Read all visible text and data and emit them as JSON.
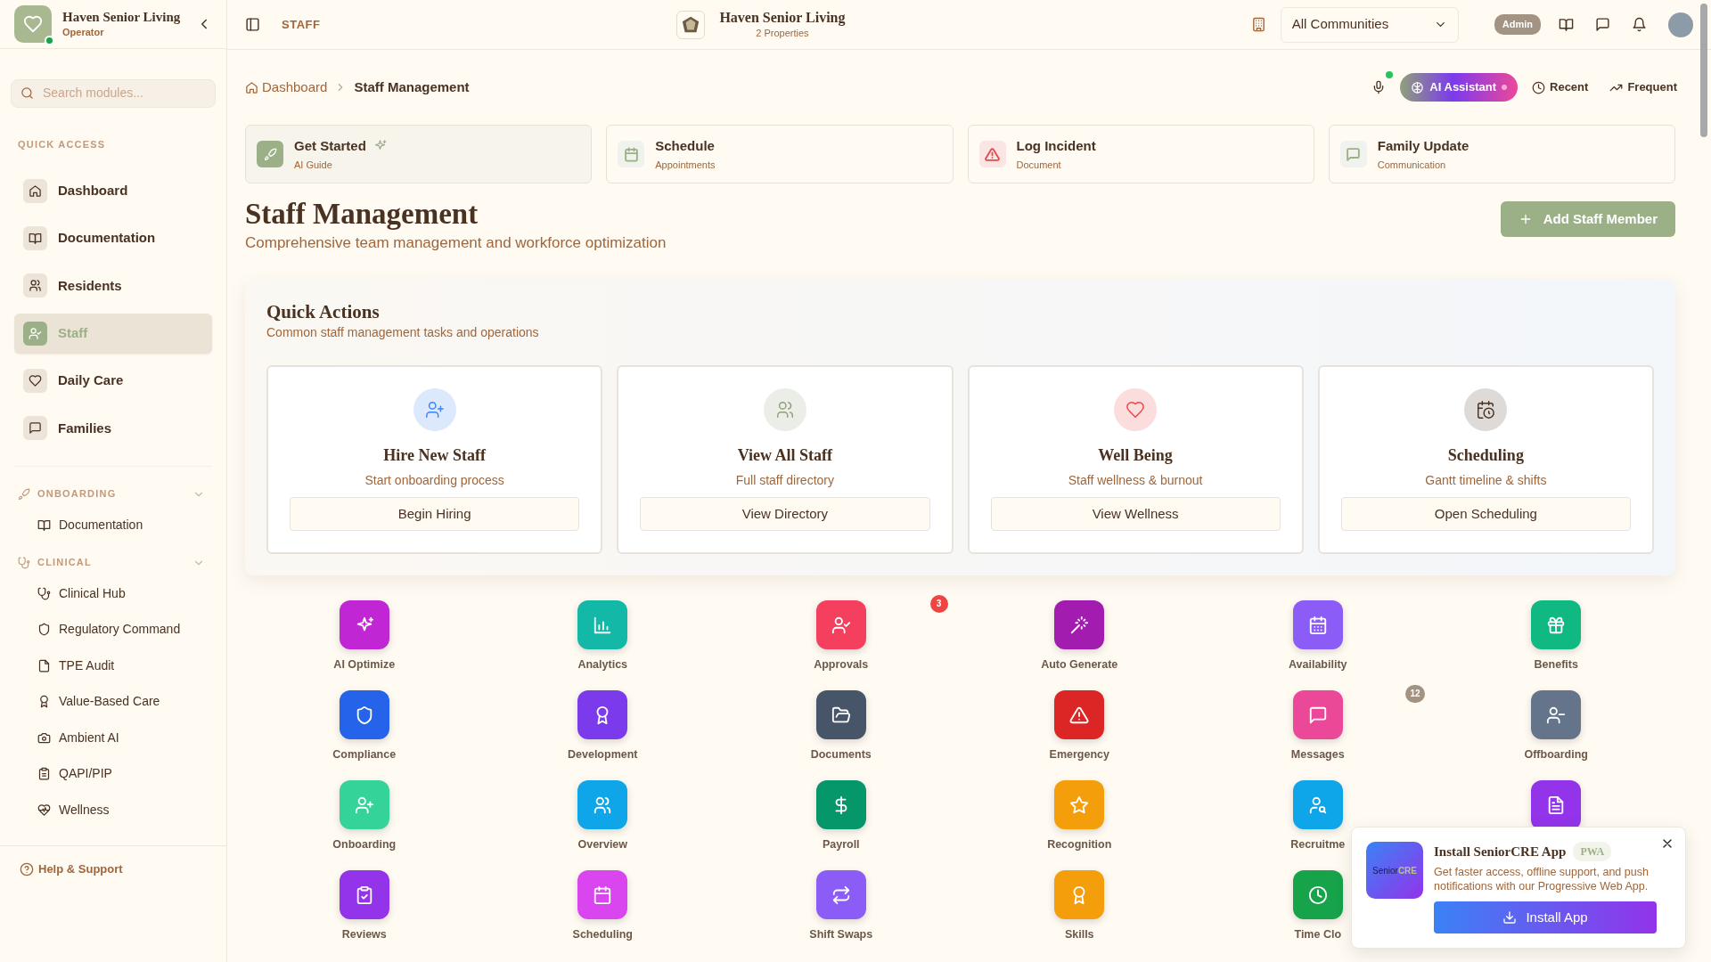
{
  "sidebar": {
    "brand": {
      "title": "Haven Senior Living",
      "subtitle": "Operator",
      "online": true
    },
    "search": {
      "placeholder": "Search modules..."
    },
    "sections": [
      {
        "title": "QUICK ACCESS",
        "kind": "main",
        "items": [
          {
            "label": "Dashboard",
            "selected": false
          },
          {
            "label": "Documentation",
            "selected": false
          },
          {
            "label": "Residents",
            "selected": false
          },
          {
            "label": "Staff",
            "selected": true
          },
          {
            "label": "Daily Care",
            "selected": false
          },
          {
            "label": "Families",
            "selected": false
          }
        ]
      },
      {
        "title": "ONBOARDING",
        "kind": "group",
        "expanded": true,
        "items": [
          {
            "label": "Documentation",
            "selected": false
          }
        ]
      },
      {
        "title": "CLINICAL",
        "kind": "group",
        "expanded": true,
        "items": [
          {
            "label": "Clinical Hub",
            "selected": false
          },
          {
            "label": "Regulatory Command",
            "selected": false
          },
          {
            "label": "TPE Audit",
            "selected": false
          },
          {
            "label": "Value-Based Care",
            "selected": false
          },
          {
            "label": "Ambient AI",
            "selected": false
          },
          {
            "label": "QAPI/PIP",
            "selected": false
          },
          {
            "label": "Wellness",
            "selected": false
          }
        ]
      }
    ],
    "footer": "Help & Support"
  },
  "topbar": {
    "section": "STAFF",
    "brand": {
      "title": "Haven Senior Living",
      "subtitle": "2 Properties"
    },
    "community_select": {
      "value": "All Communities"
    },
    "role_badge": "Admin"
  },
  "breadcrumb": [
    "Dashboard",
    "Staff Management"
  ],
  "toolbar": {
    "voice_active": true,
    "ai_button": "AI Assistant",
    "recent": "Recent",
    "frequent": "Frequent"
  },
  "shortcuts": [
    {
      "title": "Get Started",
      "subtitle": "AI Guide",
      "selected": true,
      "color": "#9cb088"
    },
    {
      "title": "Schedule",
      "subtitle": "Appointments",
      "selected": false,
      "color": "#9cb088"
    },
    {
      "title": "Log Incident",
      "subtitle": "Document",
      "selected": false,
      "color": "#e5484d"
    },
    {
      "title": "Family Update",
      "subtitle": "Communication",
      "selected": false,
      "color": "#9cb088"
    }
  ],
  "header": {
    "title": "Staff Management",
    "subtitle": "Comprehensive team management and workforce optimization",
    "add_button": "Add Staff Member"
  },
  "quick_actions": {
    "title": "Quick Actions",
    "subtitle": "Common staff management tasks and operations",
    "actions": [
      {
        "title": "Hire New Staff",
        "subtitle": "Start onboarding process",
        "button": "Begin Hiring",
        "color": "#3b82f6"
      },
      {
        "title": "View All Staff",
        "subtitle": "Full staff directory",
        "button": "View Directory",
        "color": "#8fa07a"
      },
      {
        "title": "Well Being",
        "subtitle": "Staff wellness & burnout",
        "button": "View Wellness",
        "color": "#ef4444"
      },
      {
        "title": "Scheduling",
        "subtitle": "Gantt timeline & shifts",
        "button": "Open Scheduling",
        "color": "#4a3222"
      }
    ]
  },
  "modules": [
    {
      "label": "AI Optimize",
      "color": "#c026d3"
    },
    {
      "label": "Analytics",
      "color": "#14b8a6"
    },
    {
      "label": "Approvals",
      "color": "#f43f5e",
      "badge": {
        "text": "3",
        "color": "#ef4444"
      }
    },
    {
      "label": "Auto Generate",
      "color": "#a21caf"
    },
    {
      "label": "Availability",
      "color": "#8b5cf6"
    },
    {
      "label": "Benefits",
      "color": "#10b981"
    },
    {
      "label": "Compliance",
      "color": "#2563eb"
    },
    {
      "label": "Development",
      "color": "#7c3aed"
    },
    {
      "label": "Documents",
      "color": "#475569"
    },
    {
      "label": "Emergency",
      "color": "#dc2626"
    },
    {
      "label": "Messages",
      "color": "#ec4899",
      "badge": {
        "text": "12",
        "color": "#a39383"
      }
    },
    {
      "label": "Offboarding",
      "color": "#64748b"
    },
    {
      "label": "Onboarding",
      "color": "#34d399"
    },
    {
      "label": "Overview",
      "color": "#0ea5e9"
    },
    {
      "label": "Payroll",
      "color": "#059669"
    },
    {
      "label": "Recognition",
      "color": "#f59e0b"
    },
    {
      "label": "Recruitme",
      "color": "#0ea5e9"
    },
    {
      "color": "#9333ea"
    },
    {
      "label": "Reviews",
      "color": "#9333ea"
    },
    {
      "label": "Scheduling",
      "color": "#d946ef"
    },
    {
      "label": "Shift Swaps",
      "color": "#8b5cf6"
    },
    {
      "label": "Skills",
      "color": "#f59e0b"
    },
    {
      "label": "Time Clo",
      "color": "#16a34a"
    }
  ],
  "install_popup": {
    "logo": [
      "Senior",
      "CRE"
    ],
    "title": "Install SeniorCRE App",
    "tag": "PWA",
    "text": "Get faster access, offline support, and push notifications with our Progressive Web App.",
    "button": "Install App"
  }
}
